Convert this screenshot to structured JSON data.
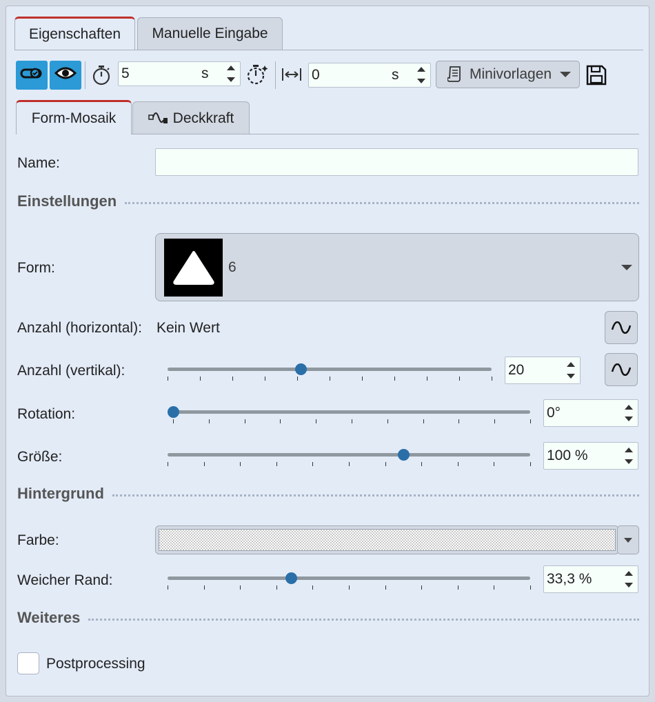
{
  "tabs": {
    "properties": "Eigenschaften",
    "manual_input": "Manuelle Eingabe"
  },
  "toolbar": {
    "duration": {
      "value": "5",
      "unit": "s"
    },
    "offset": {
      "value": "0",
      "unit": "s"
    },
    "templates_label": "Minivorlagen"
  },
  "subtabs": {
    "shape_mosaic": "Form-Mosaik",
    "opacity": "Deckkraft"
  },
  "form": {
    "name_label": "Name:",
    "name_value": "",
    "settings_section": "Einstellungen",
    "shape_label": "Form:",
    "shape_value": "6",
    "horizontal_label": "Anzahl (horizontal):",
    "horizontal_value": "Kein Wert",
    "vertical_label": "Anzahl (vertikal):",
    "vertical_value": "20",
    "rotation_label": "Rotation:",
    "rotation_value": "0°",
    "size_label": "Größe:",
    "size_value": "100 %",
    "background_section": "Hintergrund",
    "color_label": "Farbe:",
    "soft_edge_label": "Weicher Rand:",
    "soft_edge_value": "33,3 %",
    "more_section": "Weiteres",
    "postprocessing_label": "Postprocessing"
  },
  "slider_levels": {
    "vertical": 0.41,
    "rotation": 0.0,
    "size": 0.65,
    "soft_edge": 0.34
  },
  "colors": {
    "accent_blue": "#2b9ad6",
    "active_tab_marker": "#c0302b",
    "slider_thumb": "#2a6fa8",
    "panel_bg": "#e3ebf7"
  },
  "icons": [
    "link-toggle-icon",
    "eye-icon",
    "stopwatch-icon",
    "timing-icon",
    "horizontal-offset-icon",
    "template-scroll-icon",
    "save-icon",
    "opacity-wave-icon",
    "triangle-shape-icon",
    "wave-curve-icon"
  ]
}
